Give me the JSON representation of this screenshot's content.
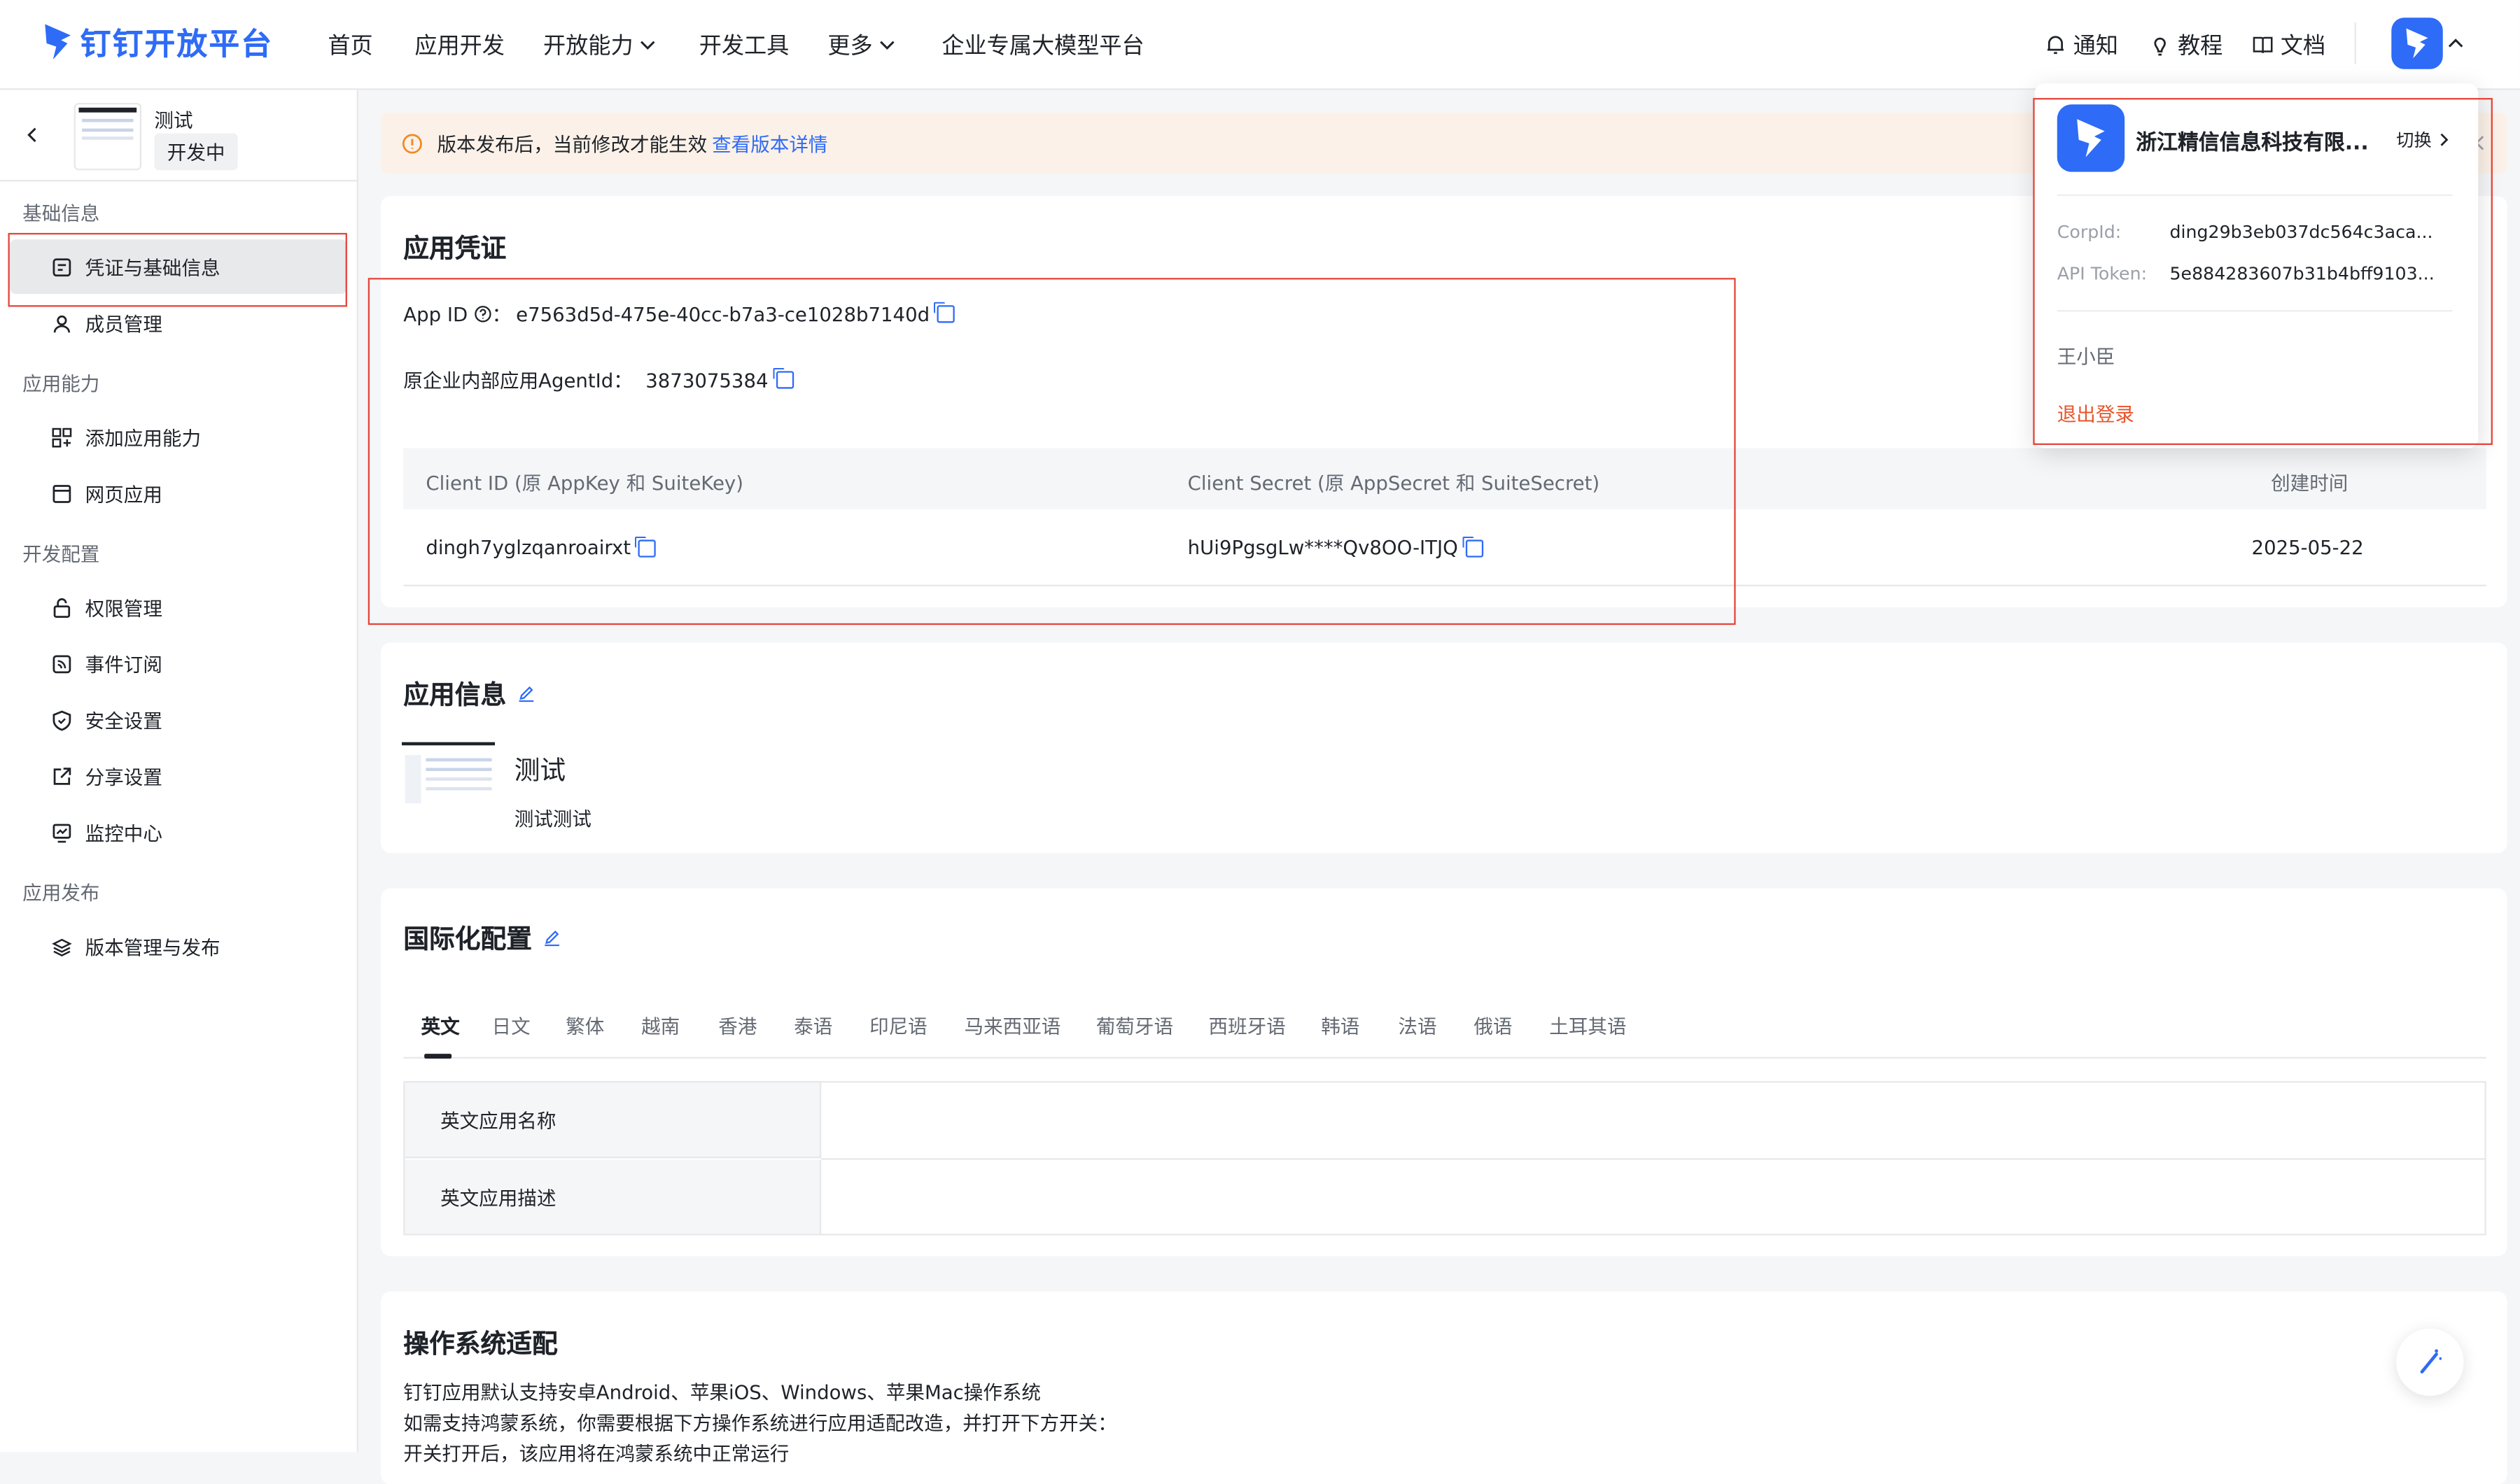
{
  "topnav": {
    "logo_text": "钉钉开放平台",
    "items": [
      "首页",
      "应用开发",
      "开放能力",
      "开发工具",
      "更多",
      "企业专属大模型平台"
    ],
    "right": {
      "notify": "通知",
      "tutorial": "教程",
      "docs": "文档"
    }
  },
  "sidebar": {
    "app_name": "测试",
    "app_status": "开发中",
    "sections": [
      {
        "title": "基础信息",
        "items": [
          "凭证与基础信息",
          "成员管理"
        ]
      },
      {
        "title": "应用能力",
        "items": [
          "添加应用能力",
          "网页应用"
        ]
      },
      {
        "title": "开发配置",
        "items": [
          "权限管理",
          "事件订阅",
          "安全设置",
          "分享设置",
          "监控中心"
        ]
      },
      {
        "title": "应用发布",
        "items": [
          "版本管理与发布"
        ]
      }
    ]
  },
  "notice": {
    "text": "版本发布后，当前修改才能生效",
    "link": "查看版本详情"
  },
  "credentials": {
    "title": "应用凭证",
    "app_id_label": "App ID",
    "app_id_colon": "：",
    "app_id": "e7563d5d-475e-40cc-b7a3-ce1028b7140d",
    "agentid_label": "原企业内部应用AgentId：",
    "agentid": "3873075384",
    "table_headers": [
      "Client ID (原 AppKey 和 SuiteKey)",
      "Client Secret (原 AppSecret 和 SuiteSecret)",
      "创建时间"
    ],
    "row": {
      "client_id": "dingh7yglzqanroairxt",
      "client_secret": "hUi9PgsgLw****Qv8OO-ITJQ",
      "created": "2025-05-22"
    }
  },
  "app_info": {
    "title": "应用信息",
    "name": "测试",
    "desc": "测试测试"
  },
  "i18n": {
    "title": "国际化配置",
    "tabs": [
      "英文",
      "日文",
      "繁体",
      "越南",
      "香港",
      "泰语",
      "印尼语",
      "马来西亚语",
      "葡萄牙语",
      "西班牙语",
      "韩语",
      "法语",
      "俄语",
      "土耳其语"
    ],
    "rows": [
      "英文应用名称",
      "英文应用描述"
    ]
  },
  "os": {
    "title": "操作系统适配",
    "lines": [
      "钉钉应用默认支持安卓Android、苹果iOS、Windows、苹果Mac操作系统",
      "如需支持鸿蒙系统，你需要根据下方操作系统进行应用适配改造，并打开下方开关：",
      "开关打开后，该应用将在鸿蒙系统中正常运行"
    ]
  },
  "popup": {
    "company": "浙江精信信息科技有限...",
    "switch": "切换",
    "corpid_label": "CorpId:",
    "corpid": "ding29b3eb037dc564c3aca...",
    "token_label": "API Token:",
    "token": "5e884283607b31b4bff9103...",
    "user": "王小臣",
    "logout": "退出登录"
  },
  "colors": {
    "brand": "#2e6bf6",
    "highlight_box": "#e5453a",
    "logout": "#e8542b",
    "notice_bg": "#fbf1e8"
  }
}
